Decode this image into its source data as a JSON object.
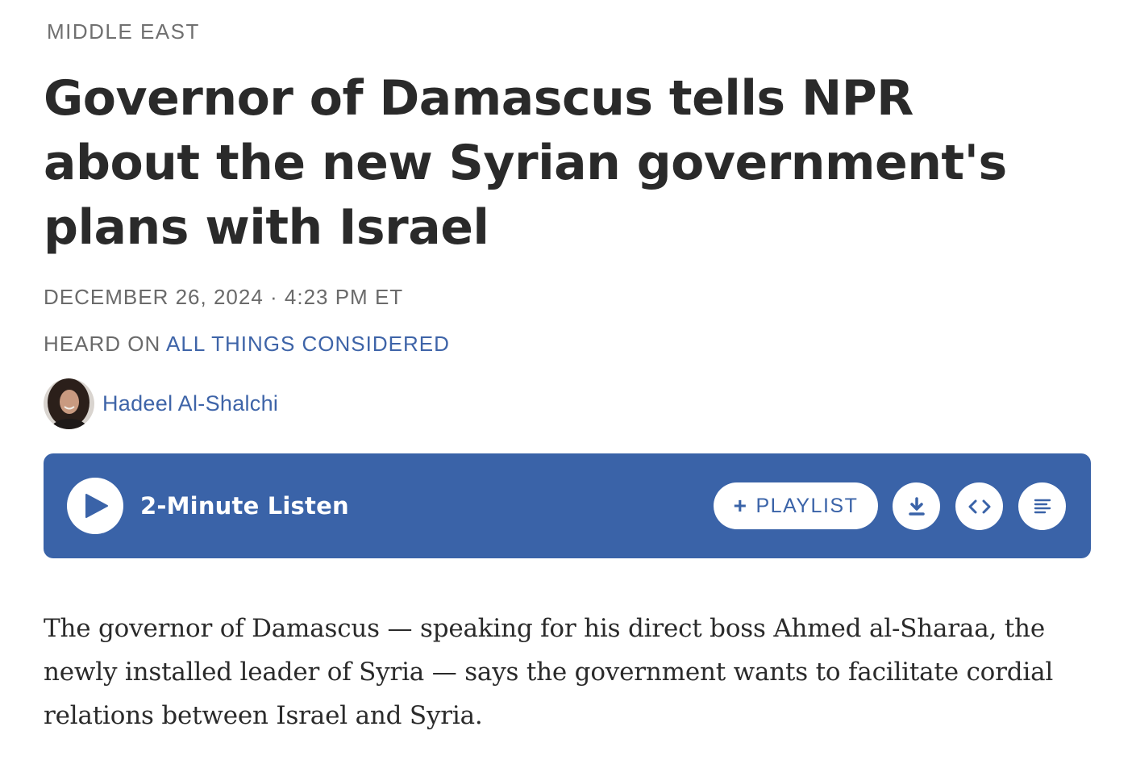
{
  "section": {
    "label": "MIDDLE EAST"
  },
  "headline": "Governor of Damascus tells NPR about the new Syrian government's plans with Israel",
  "dateline": "DECEMBER 26, 2024 · 4:23 PM ET",
  "heard_on": {
    "prefix": "HEARD ON ",
    "show": "ALL THINGS CONSIDERED"
  },
  "byline": {
    "author": "Hadeel Al-Shalchi"
  },
  "audio": {
    "listen_label": "2-Minute Listen",
    "playlist_label": "PLAYLIST",
    "accent_color": "#3a63a8",
    "icons": [
      "play-icon",
      "plus-icon",
      "download-icon",
      "embed-icon",
      "transcript-icon"
    ]
  },
  "lede": "The governor of Damascus — speaking for his direct boss Ahmed al-Sharaa, the newly installed leader of Syria — says the government wants to facilitate cordial relations between Israel and Syria."
}
